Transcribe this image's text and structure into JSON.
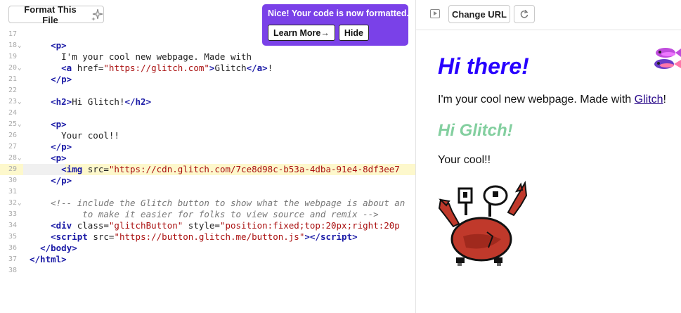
{
  "editor": {
    "format_button_label": "Format This File",
    "toast": {
      "message": "Nice! Your code is now formatted.",
      "learn_more_label": "Learn More→",
      "hide_label": "Hide"
    },
    "lines": [
      {
        "num": "17",
        "fold": false,
        "html": ""
      },
      {
        "num": "18",
        "fold": true,
        "html": "    <span class='tag'>&lt;p&gt;</span>"
      },
      {
        "num": "19",
        "fold": false,
        "html": "      <span class='txt'>I'm your cool new webpage. Made with</span>"
      },
      {
        "num": "20",
        "fold": true,
        "html": "      <span class='tag'>&lt;a</span> <span class='attr'>href=</span><span class='str'>\"https://glitch.com\"</span><span class='tag'>&gt;</span><span class='txt'>Glitch</span><span class='tag'>&lt;/a&gt;</span><span class='txt'>!</span>"
      },
      {
        "num": "21",
        "fold": false,
        "html": "    <span class='tag'>&lt;/p&gt;</span>"
      },
      {
        "num": "22",
        "fold": false,
        "html": ""
      },
      {
        "num": "23",
        "fold": true,
        "html": "    <span class='tag'>&lt;h2&gt;</span><span class='txt'>Hi Glitch!</span><span class='tag'>&lt;/h2&gt;</span>"
      },
      {
        "num": "24",
        "fold": false,
        "html": ""
      },
      {
        "num": "25",
        "fold": true,
        "html": "    <span class='tag'>&lt;p&gt;</span>"
      },
      {
        "num": "26",
        "fold": false,
        "html": "      <span class='txt'>Your cool!!</span>"
      },
      {
        "num": "27",
        "fold": false,
        "html": "    <span class='tag'>&lt;/p&gt;</span>"
      },
      {
        "num": "28",
        "fold": true,
        "html": "    <span class='tag'>&lt;p&gt;</span>"
      },
      {
        "num": "29",
        "fold": false,
        "active": true,
        "html": "      <span class='tag'>&lt;img</span> <span class='attr'>src=</span><span class='str'>\"https://cdn.glitch.com/7ce8d98c-b53a-4dba-91e4-8df3ee7</span>"
      },
      {
        "num": "30",
        "fold": false,
        "html": "    <span class='tag'>&lt;/p&gt;</span>"
      },
      {
        "num": "31",
        "fold": false,
        "html": ""
      },
      {
        "num": "32",
        "fold": true,
        "html": "    <span class='cmt'>&lt;!-- include the Glitch button to show what the webpage is about an</span>"
      },
      {
        "num": "33",
        "fold": false,
        "html": "<span class='cmt'>          to make it easier for folks to view source and remix --&gt;</span>"
      },
      {
        "num": "34",
        "fold": false,
        "html": "    <span class='tag'>&lt;div</span> <span class='attr'>class=</span><span class='str'>\"glitchButton\"</span> <span class='attr'>style=</span><span class='str'>\"position:fixed;top:20px;right:20p</span>"
      },
      {
        "num": "35",
        "fold": false,
        "html": "    <span class='tag'>&lt;script</span> <span class='attr'>src=</span><span class='str'>\"https://button.glitch.me/button.js\"</span><span class='tag'>&gt;&lt;/script&gt;</span>"
      },
      {
        "num": "36",
        "fold": false,
        "html": "  <span class='tag'>&lt;/body&gt;</span>"
      },
      {
        "num": "37",
        "fold": false,
        "html": "<span class='tag'>&lt;/html&gt;</span>"
      },
      {
        "num": "38",
        "fold": false,
        "html": ""
      }
    ]
  },
  "preview": {
    "change_url_label": "Change URL",
    "heading": "Hi there!",
    "paragraph_text": "I'm your cool new webpage. Made with ",
    "link_text": "Glitch",
    "paragraph_suffix": "!",
    "subheading": "Hi Glitch!",
    "paragraph2": "Your cool!!"
  },
  "colors": {
    "toast_bg": "#7a41e8",
    "heading": "#2800ff",
    "subheading": "#83cf9f",
    "crab_red": "#c0392b"
  }
}
